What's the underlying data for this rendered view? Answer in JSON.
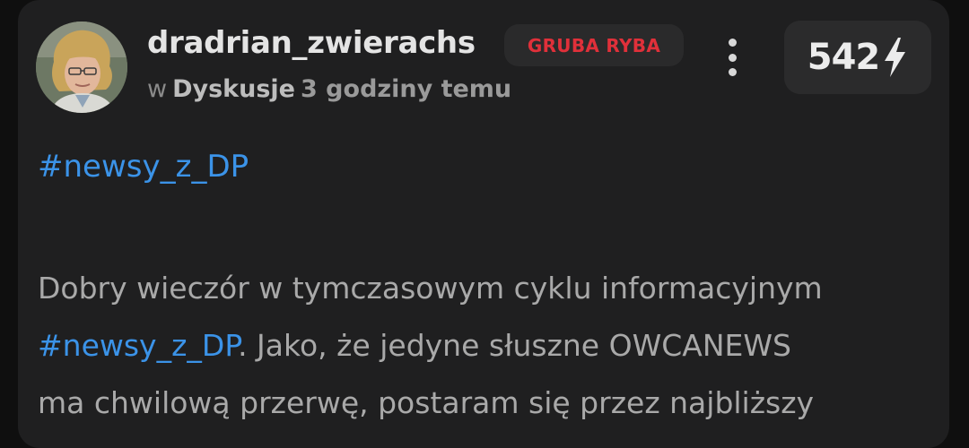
{
  "post": {
    "username": "dradrian_zwierachs",
    "badge": "GRUBA RYBA",
    "vote_count": "542",
    "meta": {
      "in_word": "w",
      "category": "Dyskusje",
      "time": "3 godziny temu"
    },
    "tag_line": "#newsy_z_DP",
    "body": {
      "line1": "Dobry wieczór w tymczasowym cyklu informacyjnym",
      "line2_tag": "#newsy_z_DP",
      "line2_rest": ". Jako, że jedyne słuszne OWCANEWS",
      "line3": "ma chwilową przerwę, postaram się przez najbliższy"
    }
  },
  "icons": {
    "more": "more-vertical-icon",
    "vote": "lightning-bolt-icon"
  },
  "colors": {
    "background": "#1f1f20",
    "accent_link": "#3b93e8",
    "badge_text": "#e0303a"
  }
}
